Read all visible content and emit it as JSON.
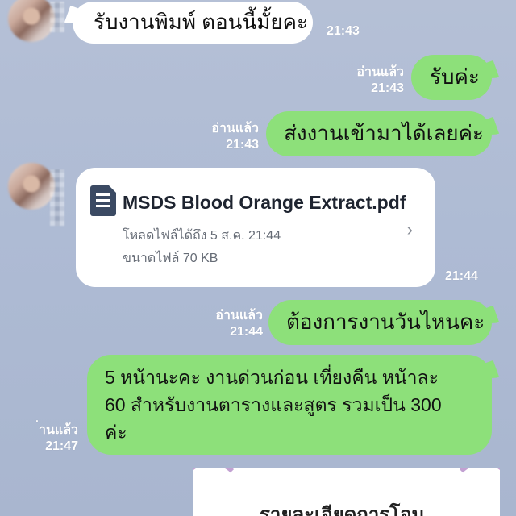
{
  "messages": [
    {
      "id": "m1",
      "side": "in",
      "text": "รับงานพิมพ์ ตอนนี้มั้ยคะ",
      "time": "21:43"
    },
    {
      "id": "m2",
      "side": "out",
      "text": "รับค่ะ",
      "read": "อ่านแล้ว",
      "time": "21:43"
    },
    {
      "id": "m3",
      "side": "out",
      "text": "ส่งงานเข้ามาได้เลยค่ะ",
      "read": "อ่านแล้ว",
      "time": "21:43"
    },
    {
      "id": "m4",
      "side": "in",
      "type": "file",
      "filename": "MSDS Blood Orange Extract.pdf",
      "download_until": "โหลดไฟล์ได้ถึง 5 ส.ค. 21:44",
      "filesize": "ขนาดไฟล์ 70 KB",
      "time": "21:44"
    },
    {
      "id": "m5",
      "side": "out",
      "text": "ต้องการงานวันไหนคะ",
      "read": "อ่านแล้ว",
      "time": "21:44"
    },
    {
      "id": "m6",
      "side": "out",
      "lines": [
        "5 หน้านะคะ  งานด่วนก่อน เที่ยงคืน หน้าละ",
        "60 สำหรับงานตารางและสูตร รวมเป็น 300",
        "ค่ะ"
      ],
      "read": "่านแล้ว",
      "time": "21:47"
    }
  ],
  "image_preview": {
    "text": "รายละเอียดการโอน"
  },
  "icons": {
    "file": "document-icon",
    "chevron": "chevron-right-icon"
  },
  "colors": {
    "outgoing_bubble": "#8de07a",
    "incoming_bubble": "#ffffff",
    "background": "#b0bdd5"
  }
}
